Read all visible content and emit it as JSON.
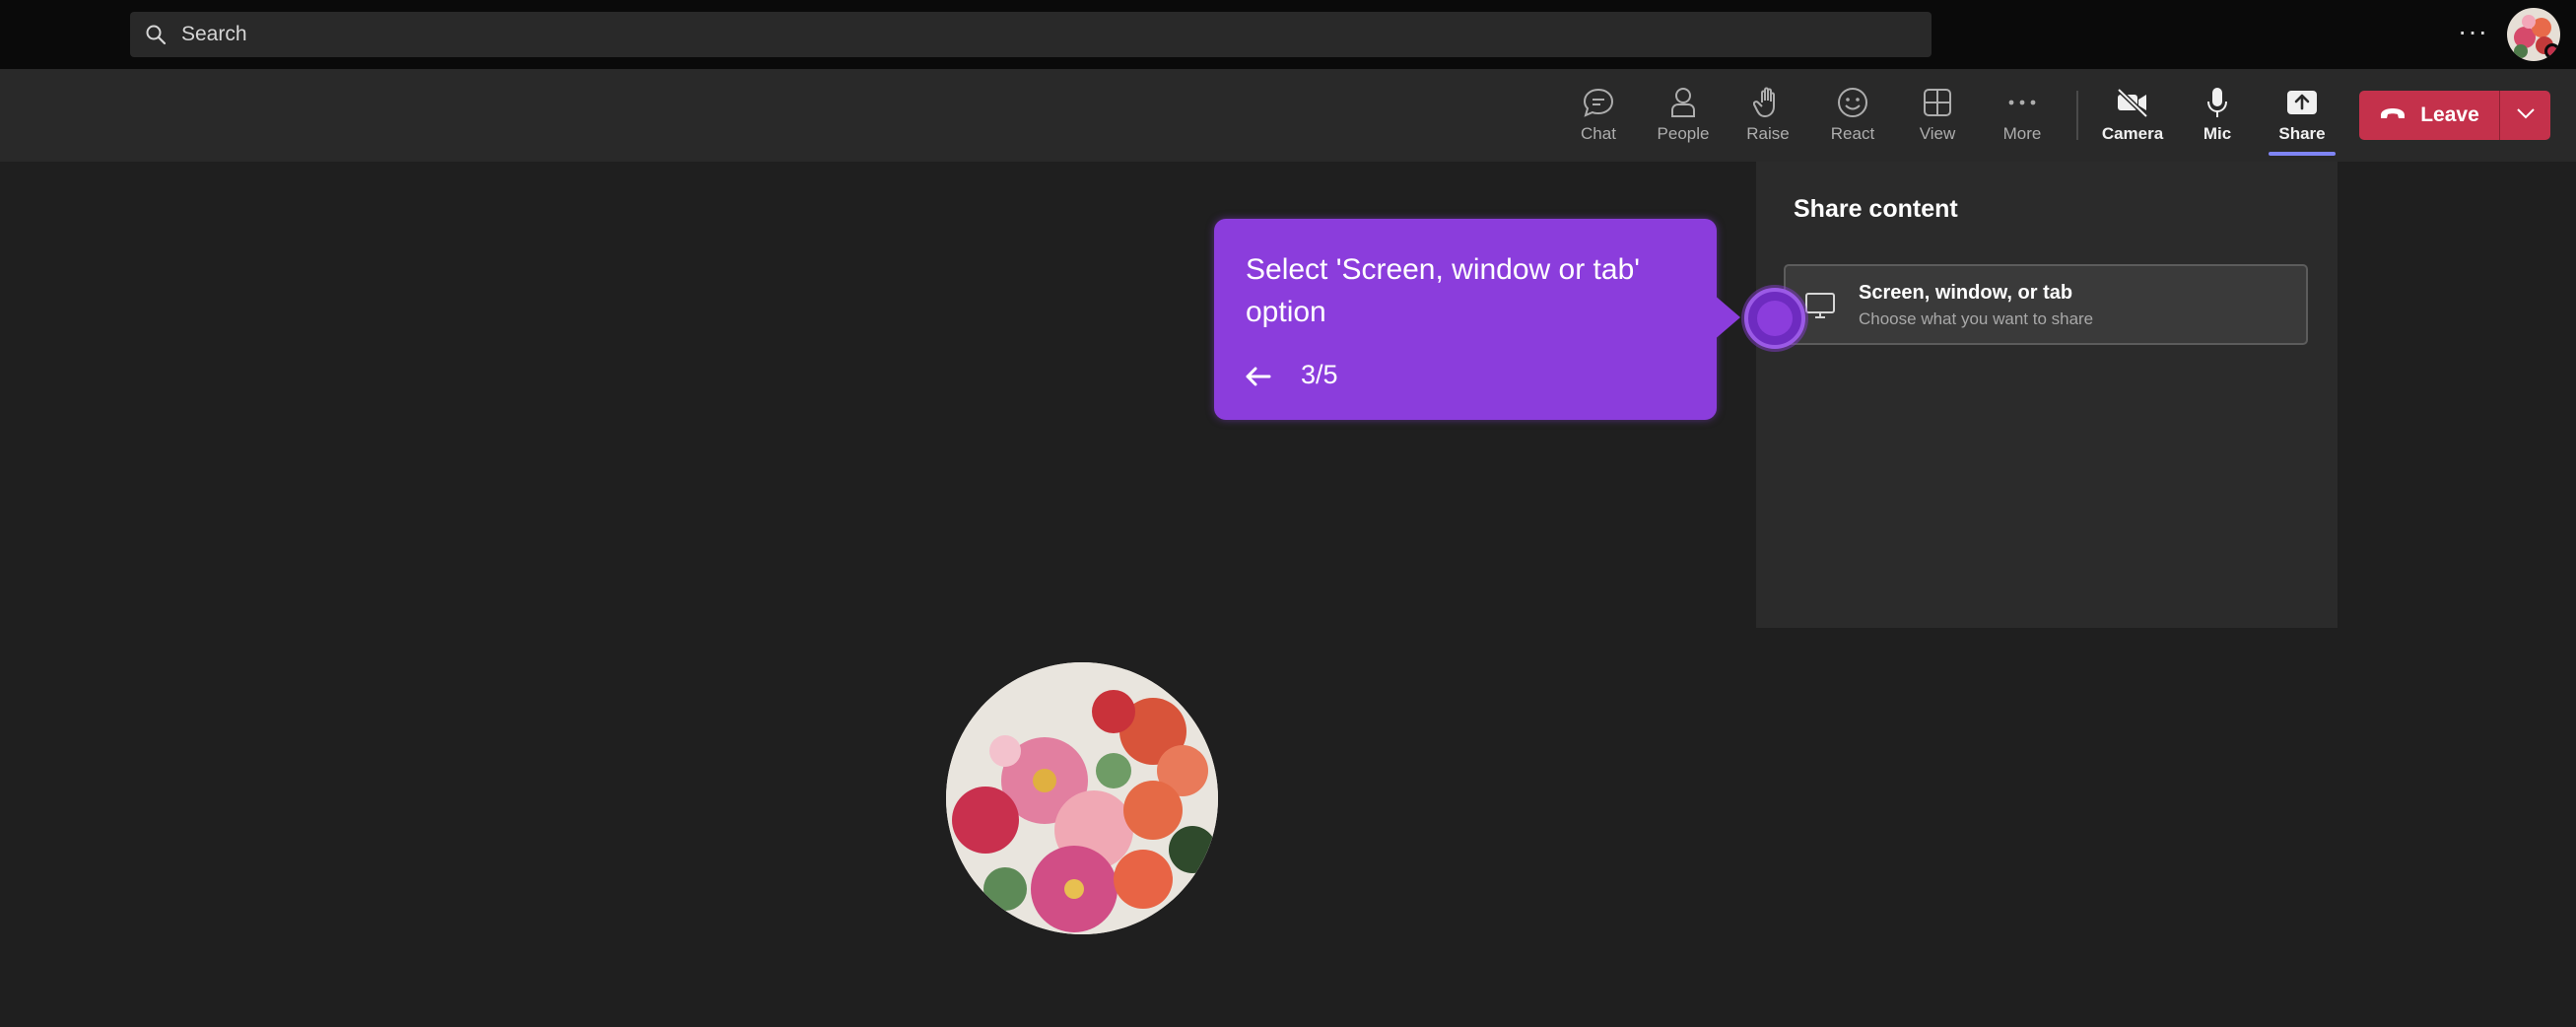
{
  "search": {
    "placeholder": "Search"
  },
  "top": {
    "more_label": "···"
  },
  "toolbar": {
    "chat": "Chat",
    "people": "People",
    "raise": "Raise",
    "react": "React",
    "view": "View",
    "more": "More",
    "camera": "Camera",
    "mic": "Mic",
    "share": "Share",
    "leave": "Leave"
  },
  "share_panel": {
    "title": "Share content",
    "option": {
      "title": "Screen, window, or tab",
      "subtitle": "Choose what you want to share"
    }
  },
  "guide": {
    "text": "Select 'Screen, window or tab' option",
    "step": "3/5"
  },
  "colors": {
    "accent_purple": "#8b3ddc",
    "leave_red": "#c4314b",
    "share_underline": "#7f85f5"
  }
}
